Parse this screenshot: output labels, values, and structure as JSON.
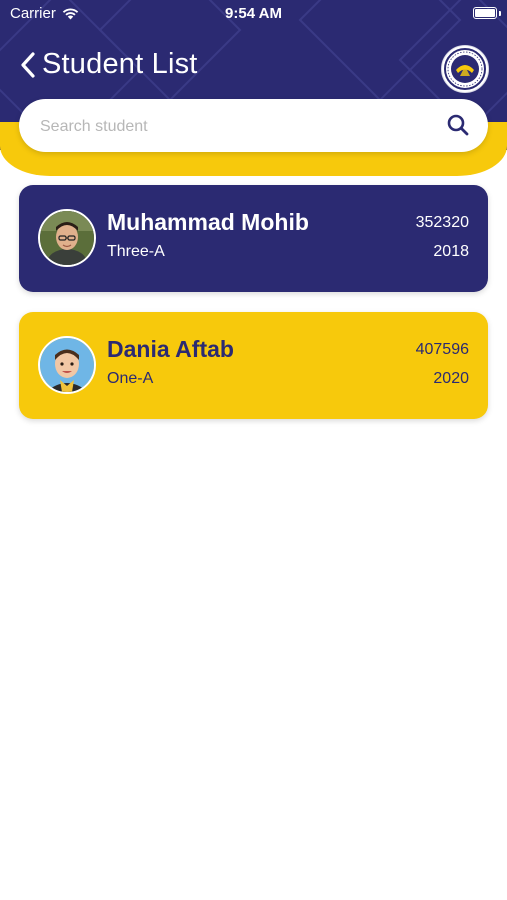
{
  "status_bar": {
    "carrier": "Carrier",
    "time": "9:54 AM"
  },
  "header": {
    "title": "Student List",
    "back_icon": "chevron-left-icon",
    "logo": "school-logo"
  },
  "search": {
    "placeholder": "Search student",
    "value": "",
    "icon": "search-icon"
  },
  "students": [
    {
      "name": "Muhammad Mohib",
      "class": "Three-A",
      "id": "352320",
      "year": "2018"
    },
    {
      "name": "Dania Aftab",
      "class": "One-A",
      "id": "407596",
      "year": "2020"
    }
  ],
  "colors": {
    "primary": "#2b2a72",
    "accent": "#f7c90c",
    "background": "#ffffff"
  }
}
